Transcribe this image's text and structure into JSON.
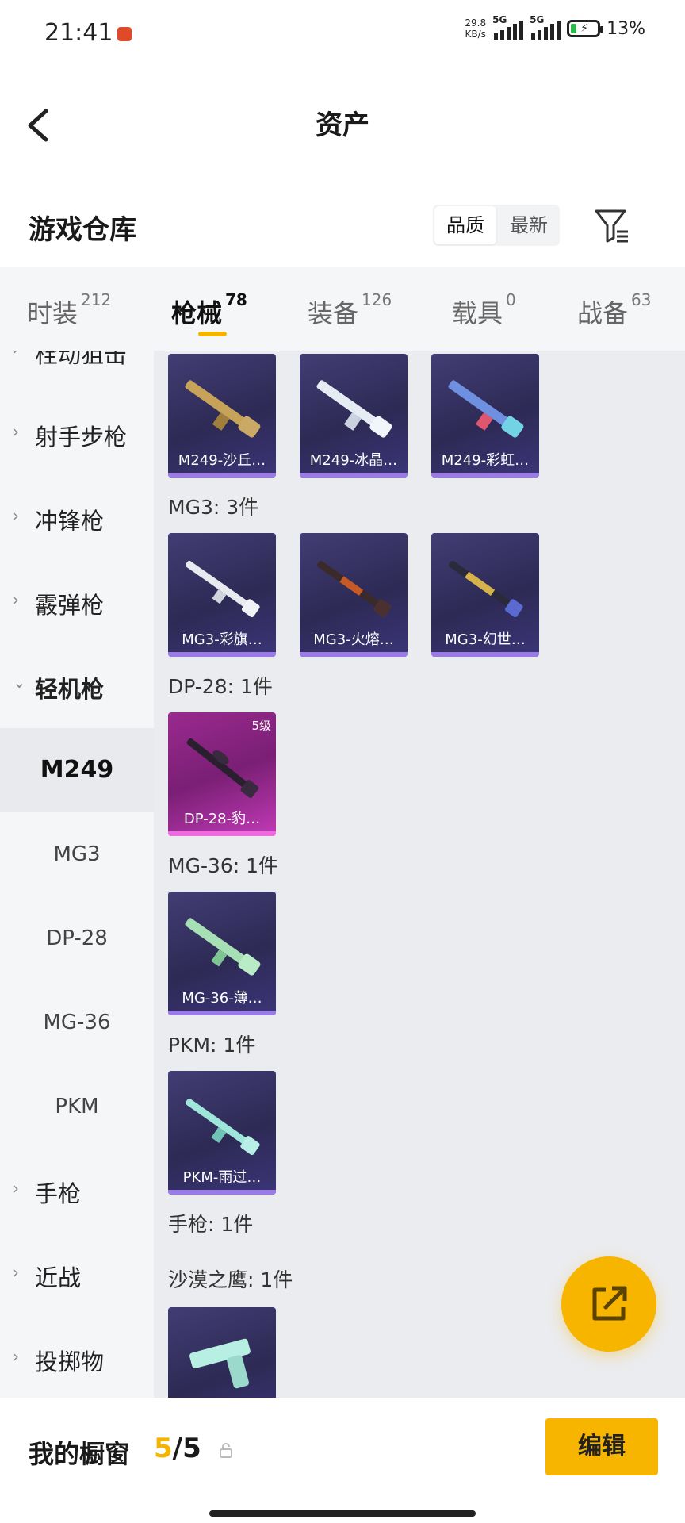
{
  "status_bar": {
    "time": "21:41",
    "net_speed_value": "29.8",
    "net_speed_unit": "KB/s",
    "signal_1_label": "5G",
    "signal_2_label": "5G",
    "battery_percent": "13%"
  },
  "header": {
    "title": "资产",
    "back_icon": "back-icon"
  },
  "warehouse": {
    "title": "游戏仓库",
    "sort_options": [
      "品质",
      "最新"
    ],
    "sort_selected": "品质",
    "filter_icon": "filter-icon"
  },
  "tabs": [
    {
      "label": "时装",
      "count": "212"
    },
    {
      "label": "枪械",
      "count": "78",
      "active": true
    },
    {
      "label": "装备",
      "count": "126"
    },
    {
      "label": "载具",
      "count": "0"
    },
    {
      "label": "战备",
      "count": "63"
    }
  ],
  "sidebar": {
    "partial_top": "栓动狙击",
    "categories": [
      "射手步枪",
      "冲锋枪",
      "霰弹枪",
      "轻机枪"
    ],
    "subitems": [
      "M249",
      "MG3",
      "DP-28",
      "MG-36",
      "PKM"
    ],
    "active_subitem": "M249",
    "bottom_categories": [
      "手枪",
      "近战",
      "投掷物"
    ]
  },
  "content": {
    "m249_cards": [
      "M249-沙丘…",
      "M249-冰晶…",
      "M249-彩虹…"
    ],
    "groups": [
      {
        "title": "MG3: 3件",
        "cards": [
          "MG3-彩旗…",
          "MG3-火熔…",
          "MG3-幻世…"
        ]
      },
      {
        "title": "DP-28: 1件",
        "cards": [
          "DP-28-豹…"
        ],
        "level": "5级"
      },
      {
        "title": "MG-36: 1件",
        "cards": [
          "MG-36-薄…"
        ]
      },
      {
        "title": "PKM: 1件",
        "cards": [
          "PKM-雨过…"
        ]
      },
      {
        "title": "手枪: 1件"
      },
      {
        "title": "沙漠之鹰: 1件"
      }
    ]
  },
  "fab": {
    "icon": "share-icon"
  },
  "bottom_bar": {
    "title": "我的橱窗",
    "current": "5",
    "separator": "/",
    "total": "5",
    "lock_icon": "lock-icon",
    "edit_label": "编辑"
  },
  "colors": {
    "accent": "#f7b500",
    "card_purple": "#2d2a55",
    "card_pink": "#9a2a8f"
  }
}
